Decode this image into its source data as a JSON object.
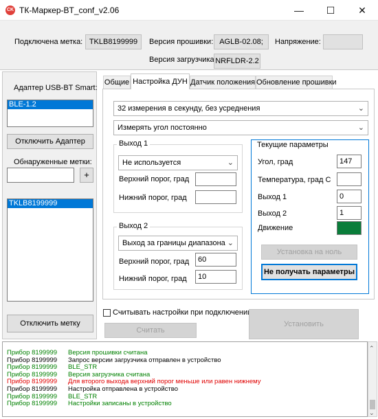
{
  "window": {
    "title": "ТК-Маркер-BT_conf_v2.06",
    "app_icon_text": "CK",
    "minimize": "—",
    "maximize": "☐",
    "close": "✕"
  },
  "header": {
    "connected_label": "Подключена метка:",
    "connected_value": "TKLB8199999",
    "firmware_label": "Версия прошивки:",
    "firmware_value": "AGLB-02.08;",
    "voltage_label": "Напряжение:",
    "voltage_value": "",
    "bootloader_label": "Версия загрузчика:",
    "bootloader_value": "NRFLDR-2.2"
  },
  "left": {
    "adapter_label": "Адаптер USB-BT Smart:",
    "adapters": [
      "BLE-1.2"
    ],
    "disconnect_adapter": "Отключить Адаптер",
    "found_label": "Обнаруженные метки:",
    "found_input": "",
    "plus": "+",
    "tags": [
      "TKLB8199999"
    ],
    "disconnect_tag": "Отключить метку"
  },
  "tabs": [
    "Общие",
    "Настройка ДУН",
    "Датчик положения",
    "Обновление прошивки"
  ],
  "settings": {
    "rate": "32 измерения в секунду, без усреднения",
    "mode": "Измерять угол постоянно",
    "out1_title": "Выход 1",
    "out1_mode": "Не используется",
    "upper_label": "Верхний порог, град",
    "lower_label": "Нижний порог, град",
    "out1_upper": "",
    "out1_lower": "",
    "out2_title": "Выход 2",
    "out2_mode": "Выход за границы диапазона",
    "out2_upper": "60",
    "out2_lower": "10"
  },
  "current": {
    "title": "Текущие параметры",
    "angle_label": "Угол, град",
    "angle_value": "147",
    "temp_label": "Температура, град С",
    "temp_value": "",
    "out1_label": "Выход 1",
    "out1_value": "0",
    "out2_label": "Выход 2",
    "out2_value": "1",
    "motion_label": "Движение",
    "motion_color": "#0a7d3a",
    "zero_button": "Установка на ноль",
    "stop_button": "Не получать параметры"
  },
  "bottom": {
    "read_on_connect": "Считывать настройки при подключении",
    "read_button": "Считать",
    "set_button": "Установить"
  },
  "log": [
    {
      "device": "Прибор 8199999",
      "text": "Версия прошивки считана",
      "color": "#008000"
    },
    {
      "device": "Прибор 8199999",
      "text": "Запрос версии загрузчика отправлен в устройство",
      "color": "#000000"
    },
    {
      "device": "Прибор 8199999",
      "text": "BLE_STR",
      "color": "#008000"
    },
    {
      "device": "Прибор 8199999",
      "text": "Версия загрузчика считана",
      "color": "#008000"
    },
    {
      "device": "Прибор 8199999",
      "text": "Для второго выхода верхний порог меньше или равен нижнему",
      "color": "#e00000"
    },
    {
      "device": "Прибор 8199999",
      "text": "Настройка отправлена в устройство",
      "color": "#000000"
    },
    {
      "device": "Прибор 8199999",
      "text": "BLE_STR",
      "color": "#008000"
    },
    {
      "device": "Прибор 8199999",
      "text": "Настройки записаны в устройство",
      "color": "#008000"
    }
  ]
}
